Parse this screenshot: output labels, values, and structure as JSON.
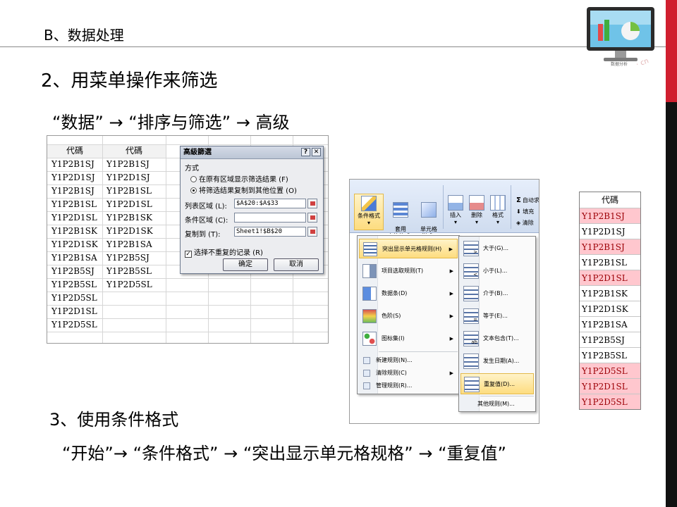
{
  "slide": {
    "section_title": "B、数据处理",
    "heading_2": "2、用菜单操作来筛选",
    "path_1": "“数据”  →  “排序与筛选” → 高级",
    "heading_3": "3、使用条件格式",
    "path_2": "“开始”→  “条件格式”  →  “突出显示单元格规格”  →  “重复值”",
    "logo_caption": "数据分析",
    "logo_watermark": "· cn",
    "colors": {
      "accent_red": "#d01f2f",
      "bar_black": "#111111",
      "dup_fill": "#ffc7ce",
      "dup_text": "#9c0006"
    }
  },
  "sheet": {
    "headers": [
      "代碼",
      "代碼"
    ],
    "col_a": [
      "Y1P2B1SJ",
      "Y1P2D1SJ",
      "Y1P2B1SJ",
      "Y1P2B1SL",
      "Y1P2D1SL",
      "Y1P2B1SK",
      "Y1P2D1SK",
      "Y1P2B1SA",
      "Y1P2B5SJ",
      "Y1P2B5SL",
      "Y1P2D5SL",
      "Y1P2D1SL",
      "Y1P2D5SL"
    ],
    "col_b": [
      "Y1P2B1SJ",
      "Y1P2D1SJ",
      "Y1P2B1SL",
      "Y1P2D1SL",
      "Y1P2B1SK",
      "Y1P2D1SK",
      "Y1P2B1SA",
      "Y1P2B5SJ",
      "Y1P2B5SL",
      "Y1P2D5SL"
    ]
  },
  "dialog": {
    "title": "高級篩選",
    "help_btn": "?",
    "close_btn": "✕",
    "group_label": "方式",
    "option_1": "在原有区域显示筛选结果 (F)",
    "option_2": "将筛选结果复制到其他位置 (O)",
    "list_range_label": "列表区域 (L):",
    "list_range_value": "$A$20:$A$33",
    "criteria_label": "条件区域 (C):",
    "criteria_value": "",
    "copy_to_label": "复制到 (T):",
    "copy_to_value": "Sheet1!$B$20",
    "unique_label": "选择不重复的记录 (R)",
    "unique_checked": true,
    "ok": "确定",
    "cancel": "取消"
  },
  "ribbon": {
    "btn_cf": "条件格式",
    "btn_table": "套用\n表格格式 ·",
    "btn_cell": "单元格\n样式 ·",
    "btn_insert": "插入",
    "btn_delete": "删除",
    "btn_format": "格式",
    "autosum": "自动求",
    "fill": "填充",
    "clear": "清除",
    "sigma": "Σ"
  },
  "cf_menu": {
    "items": [
      "突出显示单元格规则(H)",
      "项目选取规则(T)",
      "数据条(D)",
      "色阶(S)",
      "图标集(I)"
    ],
    "small_items": [
      "新建规则(N)...",
      "清除规则(C)",
      "管理规则(R)..."
    ],
    "arrow": "▶"
  },
  "hl_submenu": {
    "items": [
      "大于(G)...",
      "小于(L)...",
      "介于(B)...",
      "等于(E)...",
      "文本包含(T)...",
      "发生日期(A)...",
      "重复值(D)..."
    ],
    "more": "其他规则(M)..."
  },
  "result_list": {
    "header": "代碼",
    "rows": [
      {
        "v": "Y1P2B1SJ",
        "dup": true
      },
      {
        "v": "Y1P2D1SJ",
        "dup": false
      },
      {
        "v": "Y1P2B1SJ",
        "dup": true
      },
      {
        "v": "Y1P2B1SL",
        "dup": false
      },
      {
        "v": "Y1P2D1SL",
        "dup": true
      },
      {
        "v": "Y1P2B1SK",
        "dup": false
      },
      {
        "v": "Y1P2D1SK",
        "dup": false
      },
      {
        "v": "Y1P2B1SA",
        "dup": false
      },
      {
        "v": "Y1P2B5SJ",
        "dup": false
      },
      {
        "v": "Y1P2B5SL",
        "dup": false
      },
      {
        "v": "Y1P2D5SL",
        "dup": true
      },
      {
        "v": "Y1P2D1SL",
        "dup": true
      },
      {
        "v": "Y1P2D5SL",
        "dup": true
      }
    ]
  }
}
